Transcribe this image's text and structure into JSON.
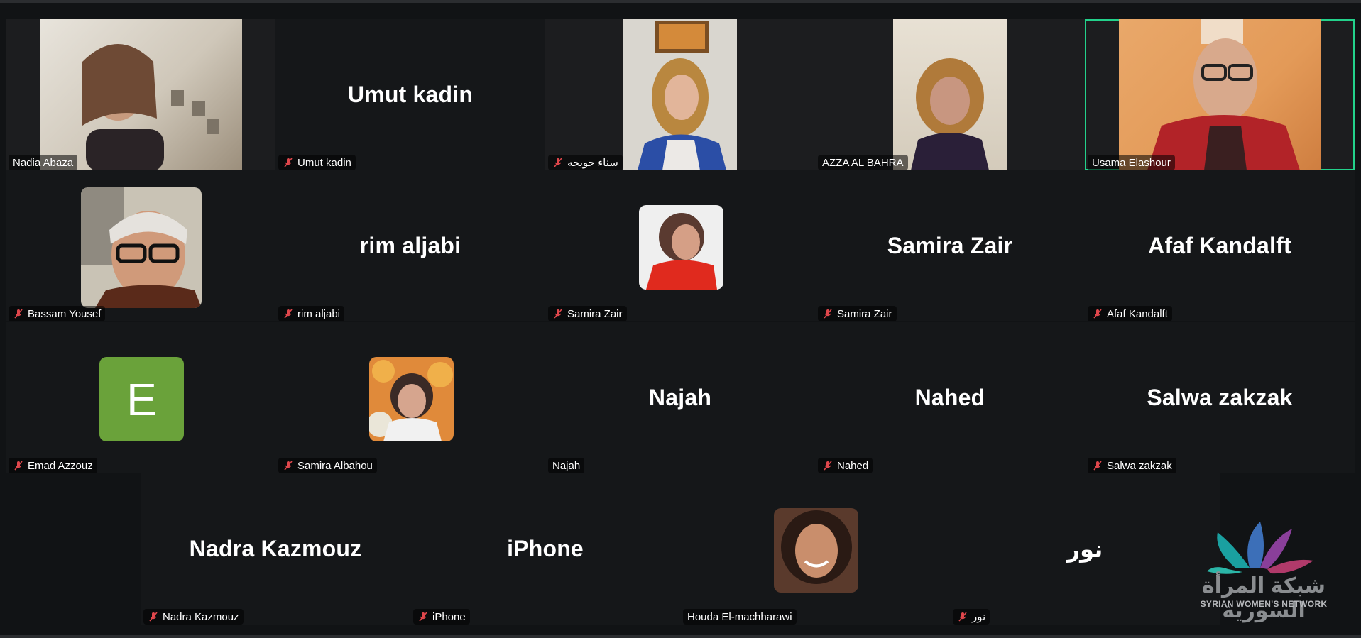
{
  "participants": [
    {
      "name": "Nadia Abaza",
      "muted": false
    },
    {
      "name": "Umut kadin",
      "muted": true
    },
    {
      "name": "سناء حويجه",
      "muted": true
    },
    {
      "name": "AZZA AL BAHRA",
      "muted": false
    },
    {
      "name": "Usama Elashour",
      "muted": false
    },
    {
      "name": "Bassam Yousef",
      "muted": true
    },
    {
      "name": "rim aljabi",
      "muted": true
    },
    {
      "name": "Samira Zair",
      "muted": true
    },
    {
      "name": "Samira Zair",
      "muted": true
    },
    {
      "name": "Afaf Kandalft",
      "muted": true
    },
    {
      "name": "Emad Azzouz",
      "muted": true,
      "avatar_letter": "E"
    },
    {
      "name": "Samira Albahou",
      "muted": true
    },
    {
      "name": "Najah",
      "muted": false
    },
    {
      "name": "Nahed",
      "muted": true
    },
    {
      "name": "Salwa zakzak",
      "muted": true
    },
    {
      "name": "Nadra Kazmouz",
      "muted": true
    },
    {
      "name": "iPhone",
      "muted": true
    },
    {
      "name": "Houda El-machharawi",
      "muted": false
    },
    {
      "name": "نور",
      "muted": true
    }
  ],
  "logo": {
    "arabic": "شبكة المرأة السورية",
    "english": "SYRIAN WOMEN'S NETWORK"
  },
  "colors": {
    "background": "#111315",
    "active_speaker_border": "#23d18b",
    "mute_icon": "#e0474c",
    "avatar_green": "#6aa23a"
  }
}
